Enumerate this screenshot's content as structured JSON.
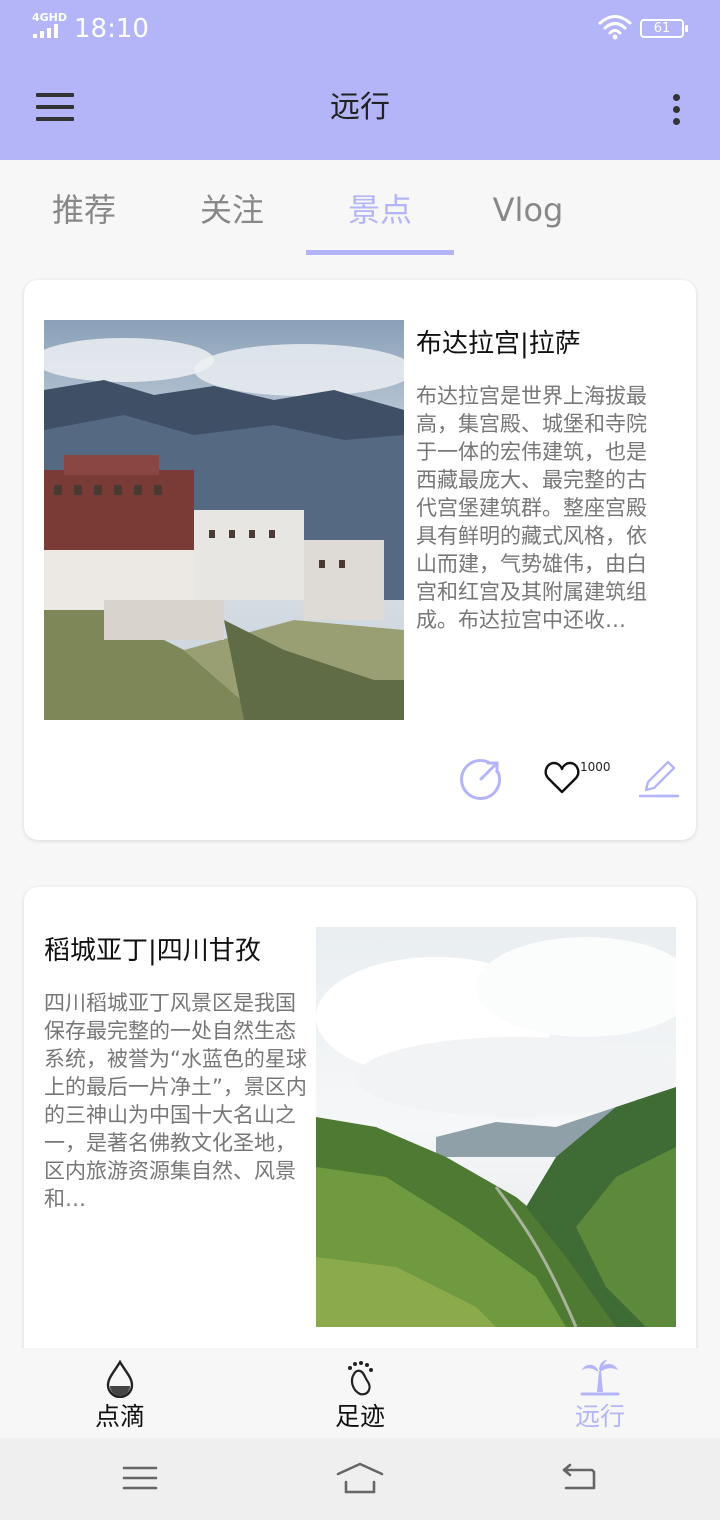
{
  "status": {
    "network": "4GHD",
    "time": "18:10",
    "battery": "61"
  },
  "header": {
    "title": "远行"
  },
  "tabs": [
    {
      "label": "推荐"
    },
    {
      "label": "关注"
    },
    {
      "label": "景点"
    },
    {
      "label": "Vlog"
    }
  ],
  "active_tab": "景点",
  "cards": [
    {
      "title": "布达拉宫|拉萨",
      "desc": "布达拉宫是世界上海拔最高，集宫殿、城堡和寺院于一体的宏伟建筑，也是西藏最庞大、最完整的古代宫堡建筑群。整座宫殿具有鲜明的藏式风格，依山而建，气势雄伟，由白宫和红宫及其附属建筑组成。布达拉宫中还收…",
      "likes": "1000"
    },
    {
      "title": "稻城亚丁|四川甘孜",
      "desc": "四川稻城亚丁风景区是我国保存最完整的一处自然生态系统，被誉为“水蓝色的星球上的最后一片净土”，景区内的三神山为中国十大名山之一，是著名佛教文化圣地，区内旅游资源集自然、风景和…"
    }
  ],
  "bottom_nav": [
    {
      "label": "点滴",
      "icon": "drop-icon"
    },
    {
      "label": "足迹",
      "icon": "footprint-icon"
    },
    {
      "label": "远行",
      "icon": "palm-tree-icon"
    }
  ],
  "colors": {
    "accent": "#b3b5f8",
    "text": "#222222",
    "muted": "#777777"
  }
}
